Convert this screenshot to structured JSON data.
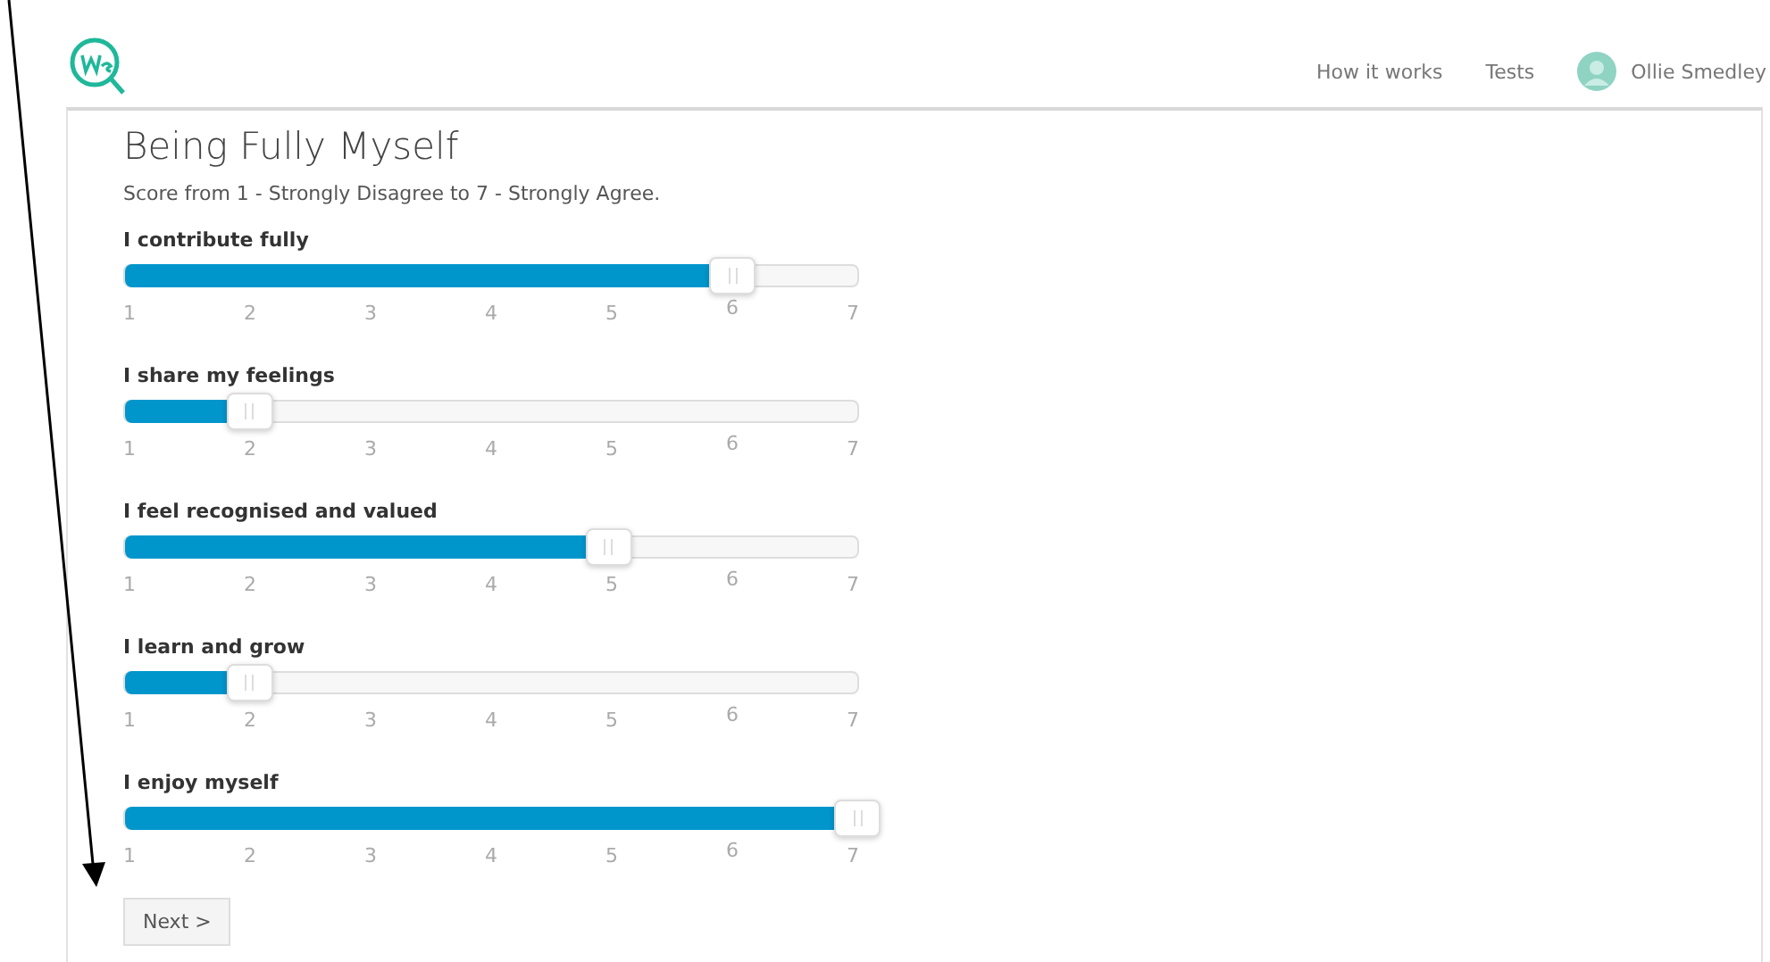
{
  "nav": {
    "links": [
      "How it works",
      "Tests"
    ],
    "user": "Ollie Smedley"
  },
  "title": "Being Fully Myself",
  "instructions": "Score from 1 - Strongly Disagree to 7 - Strongly Agree.",
  "questions": [
    {
      "label": "I contribute fully",
      "level": 0.83,
      "scale": [
        "1",
        "2",
        "3",
        "4",
        "5",
        "6",
        "7"
      ]
    },
    {
      "label": "I share my feelings",
      "level": 0.17,
      "scale": [
        "1",
        "2",
        "3",
        "4",
        "5",
        "6",
        "7"
      ]
    },
    {
      "label": "I feel recognised and valued",
      "level": 0.66,
      "scale": [
        "1",
        "2",
        "3",
        "4",
        "5",
        "6",
        "7"
      ]
    },
    {
      "label": "I learn and grow",
      "level": 0.17,
      "scale": [
        "1",
        "2",
        "3",
        "4",
        "5",
        "6",
        "7"
      ]
    },
    {
      "label": "I enjoy myself",
      "level": 1.0,
      "scale": [
        "1",
        "2",
        "3",
        "4",
        "5",
        "6",
        "7"
      ]
    }
  ],
  "next_button": "Next >"
}
